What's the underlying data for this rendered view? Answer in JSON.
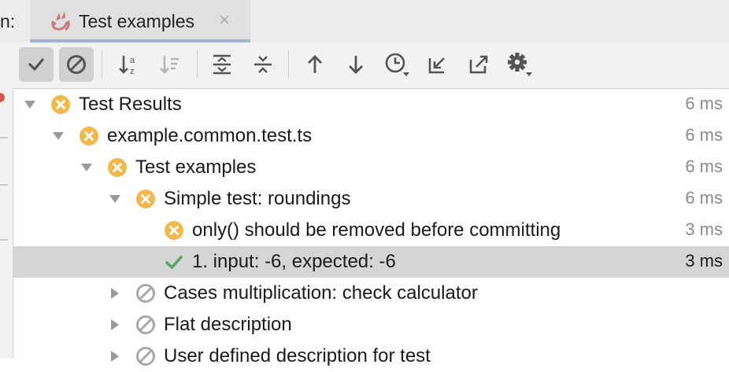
{
  "tab_strip": {
    "prefix": "n:",
    "active_tab": {
      "label": "Test examples",
      "icon": "jest-icon",
      "close_glyph": "×"
    }
  },
  "toolbar": {
    "buttons": [
      {
        "name": "show-passed-button",
        "icon": "checkmark-icon",
        "pressed": true
      },
      {
        "name": "show-ignored-button",
        "icon": "ignored-icon",
        "pressed": true
      },
      {
        "name": "sort-alphabetically-button",
        "icon": "sort-alpha-icon"
      },
      {
        "name": "sort-by-duration-button",
        "icon": "sort-duration-icon"
      },
      {
        "name": "expand-all-button",
        "icon": "expand-all-icon"
      },
      {
        "name": "collapse-all-button",
        "icon": "collapse-all-icon"
      },
      {
        "name": "previous-failed-button",
        "icon": "arrow-up-icon"
      },
      {
        "name": "next-failed-button",
        "icon": "arrow-down-icon"
      },
      {
        "name": "test-history-button",
        "icon": "clock-icon"
      },
      {
        "name": "import-tests-button",
        "icon": "import-icon"
      },
      {
        "name": "export-tests-button",
        "icon": "export-icon"
      },
      {
        "name": "settings-button",
        "icon": "gear-icon"
      }
    ]
  },
  "colors": {
    "fail": "#f2b84b",
    "pass": "#59a869",
    "ignored": "#a8a8a8",
    "selection": "#d5d5d5"
  },
  "tree": {
    "rows": [
      {
        "label": "Test Results",
        "time": "6 ms",
        "status": "failed",
        "expander": "expanded"
      },
      {
        "label": "example.common.test.ts",
        "time": "6 ms",
        "status": "failed",
        "expander": "expanded"
      },
      {
        "label": "Test examples",
        "time": "6 ms",
        "status": "failed",
        "expander": "expanded"
      },
      {
        "label": "Simple test: roundings",
        "time": "6 ms",
        "status": "failed",
        "expander": "expanded"
      },
      {
        "label": "only() should be removed before committing",
        "time": "3 ms",
        "status": "failed",
        "expander": "none"
      },
      {
        "label": "1. input: -6, expected: -6",
        "time": "3 ms",
        "status": "passed",
        "expander": "none",
        "selected": true
      },
      {
        "label": "Cases multiplication: check calculator",
        "time": "",
        "status": "ignored",
        "expander": "collapsed"
      },
      {
        "label": "Flat description",
        "time": "",
        "status": "ignored",
        "expander": "collapsed"
      },
      {
        "label": "User defined description for test",
        "time": "",
        "status": "ignored",
        "expander": "collapsed"
      }
    ]
  }
}
